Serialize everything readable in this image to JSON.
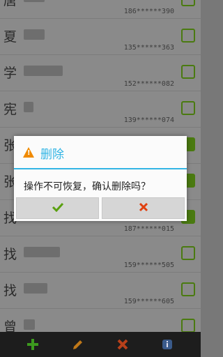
{
  "contacts": [
    {
      "name": "唐",
      "phone": "186******390",
      "checked": false
    },
    {
      "name": "夏",
      "phone": "135******363",
      "checked": false
    },
    {
      "name": "学",
      "phone": "152******082",
      "checked": false
    },
    {
      "name": "宪",
      "phone": "139******074",
      "checked": false
    },
    {
      "name": "张",
      "phone": "",
      "checked": true
    },
    {
      "name": "张",
      "phone": "",
      "checked": true
    },
    {
      "name": "找",
      "phone": "187******015",
      "checked": true
    },
    {
      "name": "找",
      "phone": "159******505",
      "checked": false
    },
    {
      "name": "找",
      "phone": "159******605",
      "checked": false
    },
    {
      "name": "曾",
      "phone": "",
      "checked": false
    }
  ],
  "dialog": {
    "title": "删除",
    "message": "操作不可恢复，确认删除吗？",
    "confirm_icon": "check-icon",
    "cancel_icon": "x-icon"
  },
  "toolbar": {
    "add_icon": "plus-icon",
    "edit_icon": "pencil-icon",
    "delete_icon": "x-icon",
    "info_icon": "info-icon"
  },
  "colors": {
    "accent": "#33b5e5",
    "warning": "#f08a00",
    "confirm": "#5aa010",
    "cancel": "#e04010",
    "checkbox": "#4a7a10"
  }
}
